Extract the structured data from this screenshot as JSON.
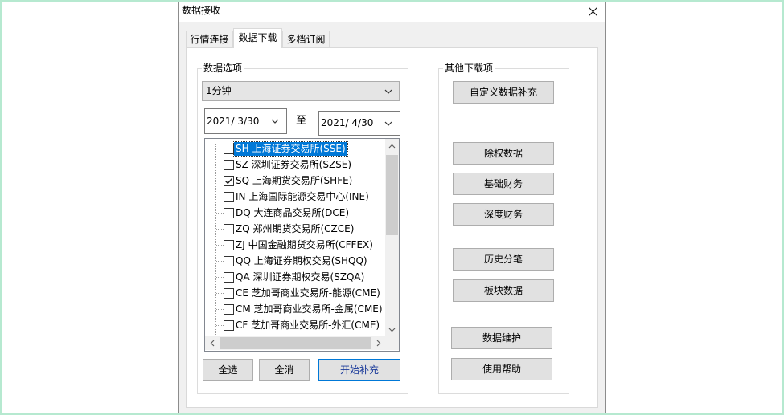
{
  "window": {
    "title": "数据接收",
    "close_icon": "close-icon"
  },
  "tabs": [
    {
      "label": "行情连接",
      "active": false
    },
    {
      "label": "数据下载",
      "active": true
    },
    {
      "label": "多档订阅",
      "active": false
    }
  ],
  "data_options": {
    "group_label": "数据选项",
    "period": {
      "value": "1分钟",
      "icon": "chevron-down-icon"
    },
    "date_from": {
      "value": "2021/ 3/30",
      "icon": "chevron-down-icon"
    },
    "date_separator": "至",
    "date_to": {
      "value": "2021/ 4/30",
      "icon": "chevron-down-icon"
    },
    "markets": [
      {
        "label": "SH 上海证券交易所(SSE)",
        "checked": false,
        "selected": true
      },
      {
        "label": "SZ 深圳证券交易所(SZSE)",
        "checked": false,
        "selected": false
      },
      {
        "label": "SQ 上海期货交易所(SHFE)",
        "checked": true,
        "selected": false
      },
      {
        "label": "IN 上海国际能源交易中心(INE)",
        "checked": false,
        "selected": false
      },
      {
        "label": "DQ 大连商品交易所(DCE)",
        "checked": false,
        "selected": false
      },
      {
        "label": "ZQ 郑州期货交易所(CZCE)",
        "checked": false,
        "selected": false
      },
      {
        "label": "ZJ 中国金融期货交易所(CFFEX)",
        "checked": false,
        "selected": false
      },
      {
        "label": "QQ 上海证券期权交易(SHQQ)",
        "checked": false,
        "selected": false
      },
      {
        "label": "QA 深圳证券期权交易(SZQA)",
        "checked": false,
        "selected": false
      },
      {
        "label": "CE 芝加哥商业交易所-能源(CME)",
        "checked": false,
        "selected": false
      },
      {
        "label": "CM 芝加哥商业交易所-金属(CME)",
        "checked": false,
        "selected": false
      },
      {
        "label": "CF 芝加哥商业交易所-外汇(CME)",
        "checked": false,
        "selected": false
      }
    ],
    "buttons": {
      "select_all": "全选",
      "clear_all": "全消",
      "start": "开始补充"
    }
  },
  "other_downloads": {
    "group_label": "其他下载项",
    "buttons": {
      "custom_supplement": "自定义数据补充",
      "ex_rights": "除权数据",
      "basic_finance": "基础财务",
      "deep_finance": "深度财务",
      "tick_history": "历史分笔",
      "sector_data": "板块数据",
      "maintenance": "数据维护",
      "help": "使用帮助"
    }
  },
  "colors": {
    "selection": "#0078d7",
    "default_button_border": "#0078d7",
    "button_face": "#e1e1e1",
    "dialog_background": "#f0f0f0"
  }
}
